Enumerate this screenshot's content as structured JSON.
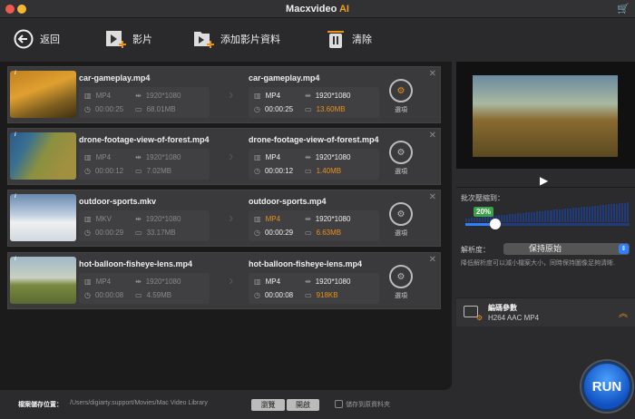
{
  "app": {
    "title": "Macxvideo",
    "title_accent": "AI"
  },
  "toolbar": {
    "back": "返回",
    "video": "影片",
    "add_folder": "添加影片資料",
    "clear": "清除"
  },
  "items": [
    {
      "src_name": "car-gameplay.mp4",
      "src_format": "MP4",
      "src_res": "1920*1080",
      "src_dur": "00:00:25",
      "src_size": "68.01MB",
      "out_name": "car-gameplay.mp4",
      "out_format": "MP4",
      "out_res": "1920*1080",
      "out_dur": "00:00:25",
      "out_size": "13.60MB",
      "option": "選項",
      "info": "i"
    },
    {
      "src_name": "drone-footage-view-of-forest.mp4",
      "src_format": "MP4",
      "src_res": "1920*1080",
      "src_dur": "00:00:12",
      "src_size": "7.02MB",
      "out_name": "drone-footage-view-of-forest.mp4",
      "out_format": "MP4",
      "out_res": "1920*1080",
      "out_dur": "00:00:12",
      "out_size": "1.40MB",
      "option": "選項",
      "info": "i"
    },
    {
      "src_name": "outdoor-sports.mkv",
      "src_format": "MKV",
      "src_res": "1920*1080",
      "src_dur": "00:00:29",
      "src_size": "33.17MB",
      "out_name": "outdoor-sports.mp4",
      "out_format": "MP4",
      "out_res": "1920*1080",
      "out_dur": "00:00:29",
      "out_size": "6.63MB",
      "option": "選項",
      "info": "i"
    },
    {
      "src_name": "hot-balloon-fisheye-lens.mp4",
      "src_format": "MP4",
      "src_res": "1920*1080",
      "src_dur": "00:00:08",
      "src_size": "4.59MB",
      "out_name": "hot-balloon-fisheye-lens.mp4",
      "out_format": "MP4",
      "out_res": "1920*1080",
      "out_dur": "00:00:08",
      "out_size": "918KB",
      "option": "選項",
      "info": "i"
    }
  ],
  "compress": {
    "label": "批次壓縮到：",
    "percent": 20,
    "percent_label": "20%"
  },
  "resolution": {
    "label": "解析度：",
    "value": "保持原始",
    "hint": "降低解析度可以減小檔案大小，同時保持圖像足夠清晰."
  },
  "codec": {
    "title": "編碼參數",
    "value": "H264 AAC MP4"
  },
  "bottom": {
    "label": "檔案儲存位置：",
    "path": "/Users/digiarty.support/Movies/Mac Video Library",
    "browse": "瀏覽",
    "open": "開啟",
    "save_to_source": "儲存到原資料夾"
  },
  "run": "RUN",
  "colors": {
    "accent": "#e8901a",
    "blue": "#2f7fff",
    "green": "#3aa14a"
  }
}
